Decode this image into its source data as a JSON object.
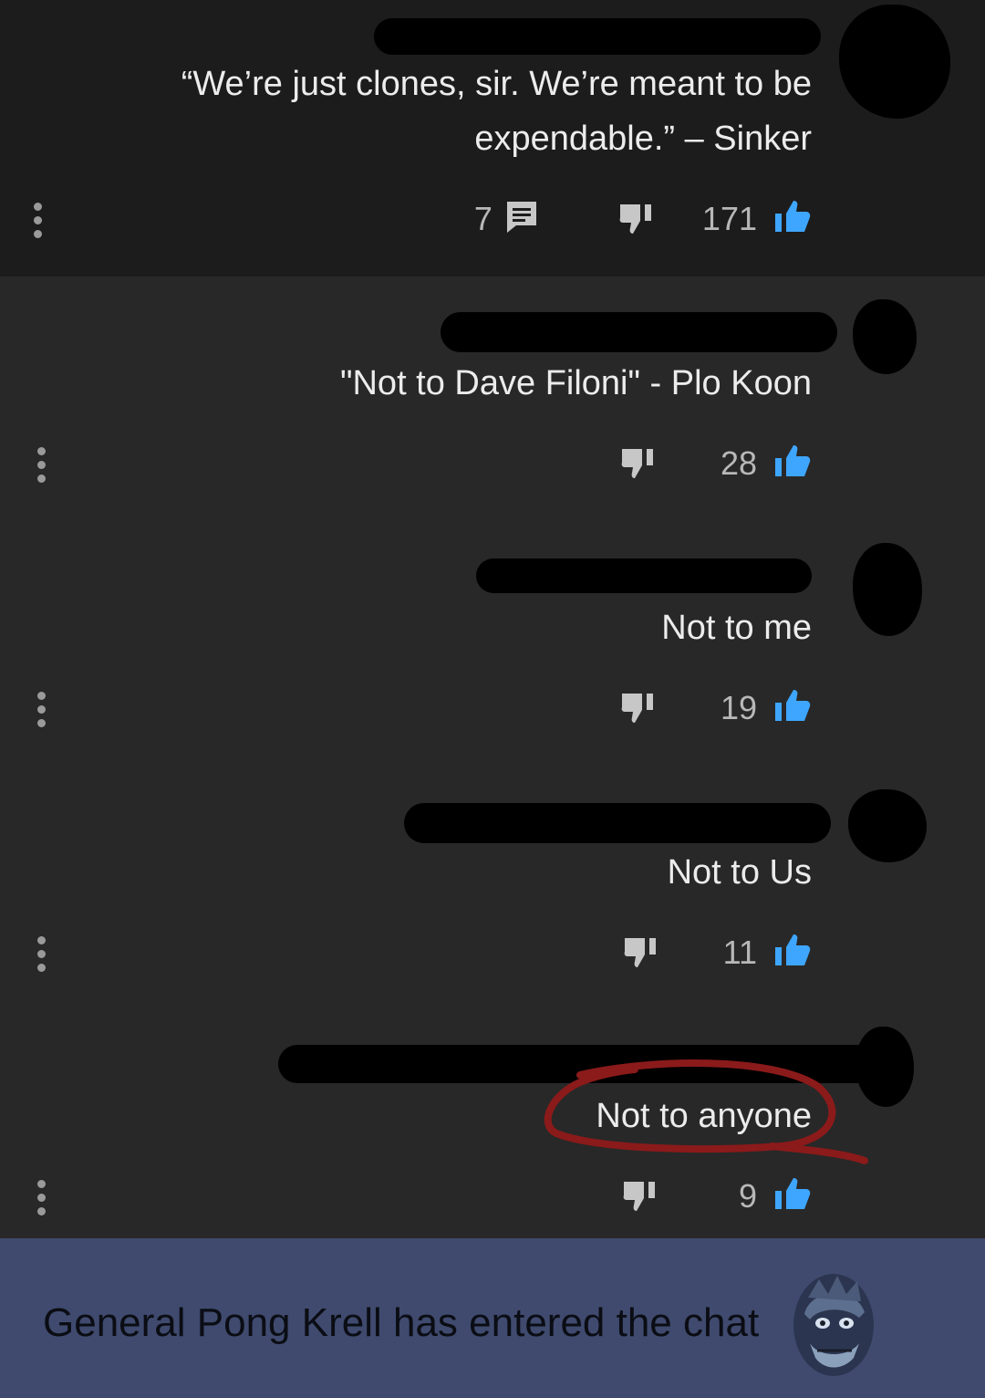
{
  "comments": [
    {
      "text_line1": "“We’re just clones, sir. We’re meant to be",
      "text_line2": "expendable.” – Sinker",
      "reply_count": "7",
      "likes": "171"
    },
    {
      "text": "\"Not to Dave Filoni\" - Plo Koon",
      "likes": "28"
    },
    {
      "text": "Not to me",
      "likes": "19"
    },
    {
      "text": "Not to Us",
      "likes": "11"
    },
    {
      "text": "Not to anyone",
      "likes": "9"
    }
  ],
  "banner": {
    "text": "General Pong Krell has entered the chat"
  },
  "colors": {
    "like_blue": "#3ea6ff",
    "annotation_red": "#8b1a1a",
    "banner_bg": "#3f4a6e"
  },
  "icons": {
    "menu": "more-vert-icon",
    "reply": "comment-icon",
    "dislike": "thumb-down-icon",
    "like": "thumb-up-icon"
  }
}
